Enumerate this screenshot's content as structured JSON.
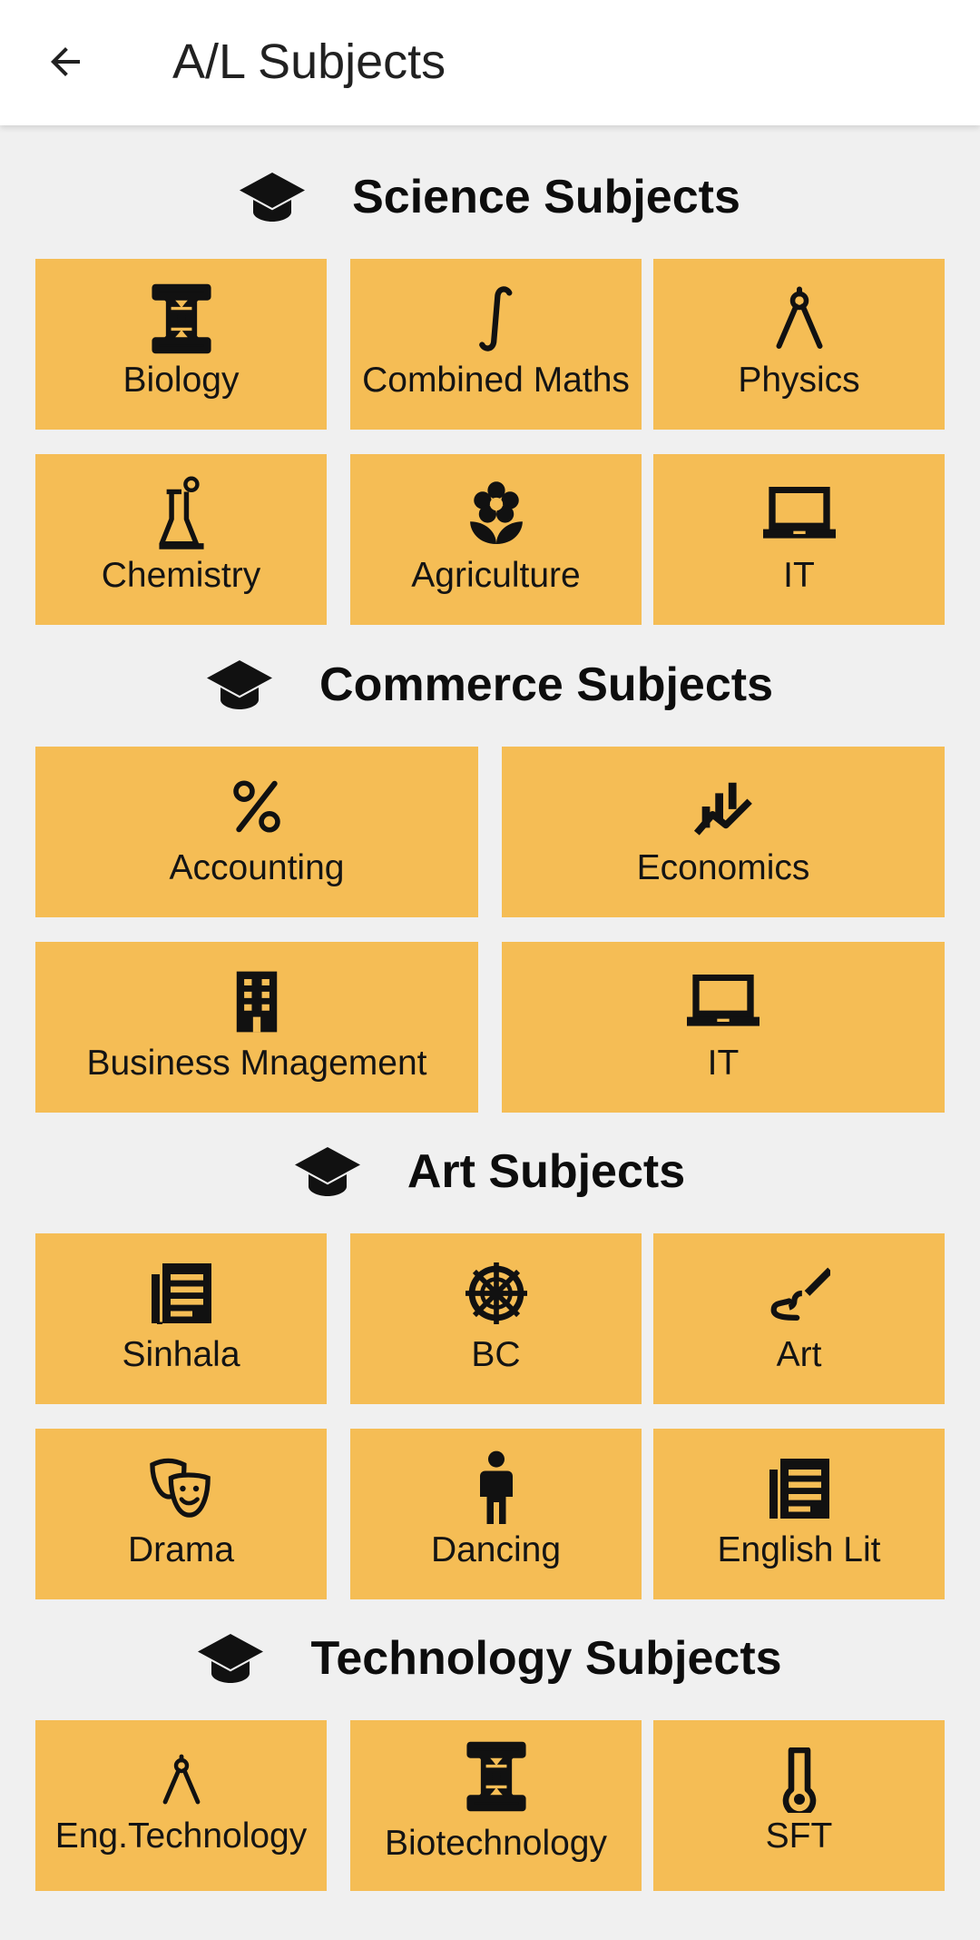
{
  "appbar": {
    "title": "A/L Subjects",
    "back_icon": "arrow-back-icon"
  },
  "colors": {
    "tile_bg": "#f5bd55",
    "page_bg": "#f0f0f0",
    "appbar_bg": "#ffffff",
    "text": "#111111"
  },
  "sections": {
    "science": {
      "title": "Science Subjects",
      "icon": "graduation-cap-icon",
      "items": [
        {
          "label": "Biology",
          "icon": "dna-icon"
        },
        {
          "label": "Combined Maths",
          "icon": "integral-icon"
        },
        {
          "label": "Physics",
          "icon": "compass-icon"
        },
        {
          "label": "Chemistry",
          "icon": "flask-icon"
        },
        {
          "label": "Agriculture",
          "icon": "flower-icon"
        },
        {
          "label": "IT",
          "icon": "laptop-icon"
        }
      ]
    },
    "commerce": {
      "title": "Commerce Subjects",
      "icon": "graduation-cap-icon",
      "items": [
        {
          "label": "Accounting",
          "icon": "percent-icon"
        },
        {
          "label": "Economics",
          "icon": "chart-trend-icon"
        },
        {
          "label": "Business Mnagement",
          "icon": "building-icon"
        },
        {
          "label": "IT",
          "icon": "laptop-icon"
        }
      ]
    },
    "art": {
      "title": "Art Subjects",
      "icon": "graduation-cap-icon",
      "items": [
        {
          "label": "Sinhala",
          "icon": "article-icon"
        },
        {
          "label": "BC",
          "icon": "dharma-wheel-icon"
        },
        {
          "label": "Art",
          "icon": "brush-icon"
        },
        {
          "label": "Drama",
          "icon": "theater-masks-icon"
        },
        {
          "label": "Dancing",
          "icon": "person-icon"
        },
        {
          "label": "English Lit",
          "icon": "article-icon"
        }
      ]
    },
    "technology": {
      "title": "Technology Subjects",
      "icon": "graduation-cap-icon",
      "items": [
        {
          "label": "Eng.Technology",
          "icon": "compass-icon"
        },
        {
          "label": "Biotechnology",
          "icon": "dna-icon"
        },
        {
          "label": "SFT",
          "icon": "thermometer-icon"
        }
      ]
    }
  }
}
